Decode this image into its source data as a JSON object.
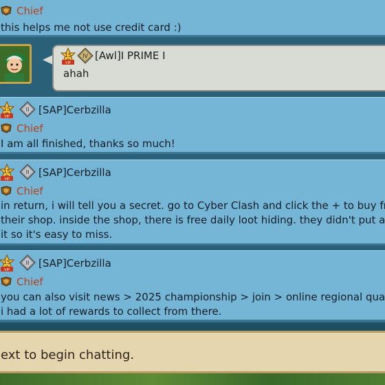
{
  "messages": [
    {
      "rank": "Chief",
      "lines": [
        "this helps me not use credit card :)"
      ]
    },
    {
      "self": true,
      "vip_level": "15",
      "guild_rank_numeral": "IV",
      "sender": "[Awl]I  PRIME  I",
      "lines": [
        "ahah"
      ]
    },
    {
      "vip_level": "15",
      "guild_rank_numeral": "II",
      "sender": "[SAP]Cerbzilla",
      "rank": "Chief",
      "lines": [
        "I am all finished, thanks so much!"
      ]
    },
    {
      "vip_level": "15",
      "guild_rank_numeral": "II",
      "sender": "[SAP]Cerbzilla",
      "rank": "Chief",
      "lines": [
        "in return, i will tell you a secret. go to Cyber Clash and click the + to buy fro",
        "their shop. inside the shop, there is free daily loot hiding. they didn't put a",
        "it so it's easy to miss."
      ]
    },
    {
      "vip_level": "15",
      "guild_rank_numeral": "II",
      "sender": "[SAP]Cerbzilla",
      "rank": "Chief",
      "lines": [
        "you can also visit news > 2025 championship > join > online regional quali",
        "i had a lot of rewards to collect from there."
      ]
    }
  ],
  "input": {
    "placeholder": "ext to begin chatting."
  },
  "colors": {
    "message_bg": "#75b5d6",
    "rank_text": "#b4431c",
    "input_bg": "#e6d6b0",
    "bubble_bg": "#d9dcd4"
  },
  "icons": {
    "vip": "vip-badge-icon",
    "guild_rank": "guild-rank-diamond-icon",
    "rank": "chief-rank-icon",
    "avatar": "player-avatar"
  }
}
